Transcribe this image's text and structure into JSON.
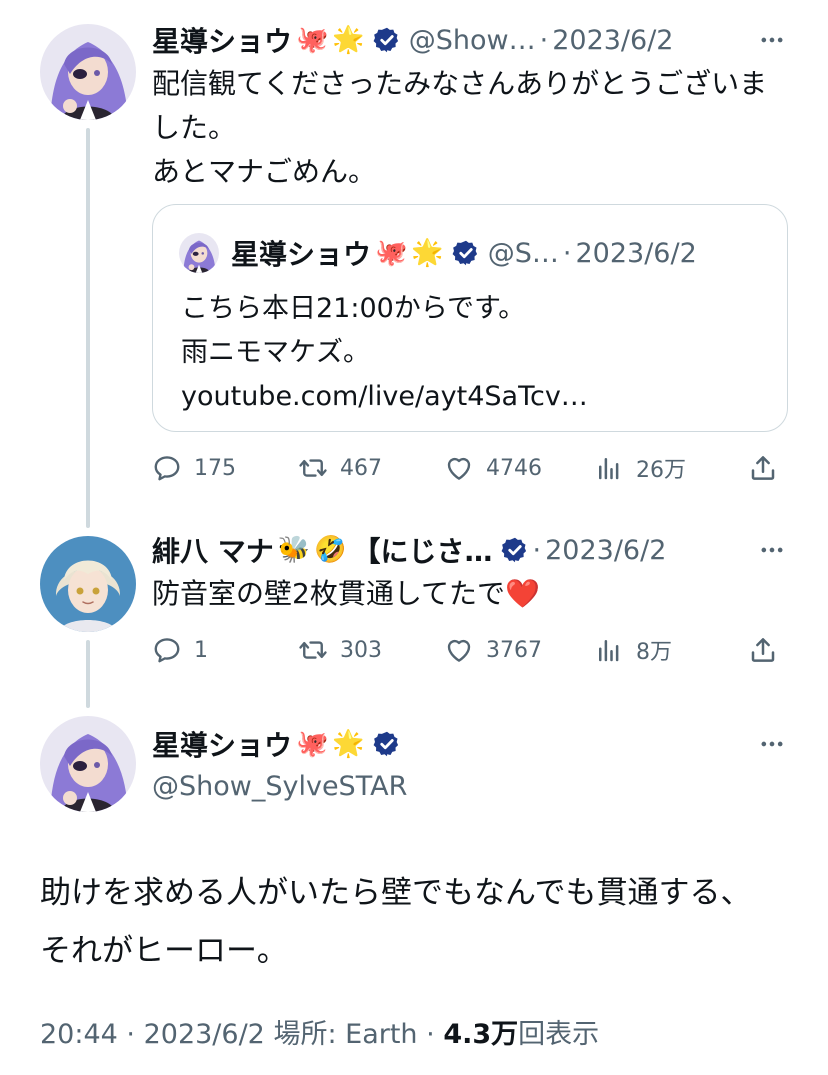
{
  "tweet1": {
    "name": "星導ショウ",
    "emojis": [
      "🐙",
      "🌟"
    ],
    "handle": "@Show…",
    "separator": "·",
    "date": "2023/6/2",
    "text": "配信観てくださったみなさんありがとうございました。\nあとマナごめん。",
    "quote": {
      "name": "星導ショウ",
      "emojis": [
        "🐙",
        "🌟"
      ],
      "handle": "@S…",
      "separator": "·",
      "date": "2023/6/2",
      "text": "こちら本日21:00からです。\n雨ニモマケズ。\nyoutube.com/live/ayt4SaTcv…"
    },
    "actions": {
      "replies": "175",
      "retweets": "467",
      "likes": "4746",
      "views": "26万"
    }
  },
  "tweet2": {
    "name": "緋八 マナ",
    "emojis": [
      "🐝",
      "🤣"
    ],
    "name_suffix": "【にじさ…",
    "separator": "·",
    "date": "2023/6/2",
    "text": "防音室の壁2枚貫通してたで❤️",
    "actions": {
      "replies": "1",
      "retweets": "303",
      "likes": "3767",
      "views": "8万"
    }
  },
  "main": {
    "name": "星導ショウ",
    "emojis": [
      "🐙",
      "🌟"
    ],
    "handle": "@Show_SylveSTAR",
    "text": "助けを求める人がいたら壁でもなんでも貫通する、それがヒーロー。",
    "meta": {
      "time": "20:44",
      "dot1": "·",
      "date": "2023/6/2",
      "location": "場所: Earth",
      "dot2": "·",
      "views_count": "4.3万",
      "views_label": "回表示"
    }
  },
  "colors": {
    "text": "#0f1419",
    "muted": "#536471",
    "border": "#cfd9de",
    "verified": "#1d4ed8"
  },
  "icons": {
    "more": "more-icon",
    "reply": "reply-icon",
    "retweet": "retweet-icon",
    "like": "like-icon",
    "views": "views-icon",
    "share": "share-icon",
    "verified": "verified-icon"
  }
}
